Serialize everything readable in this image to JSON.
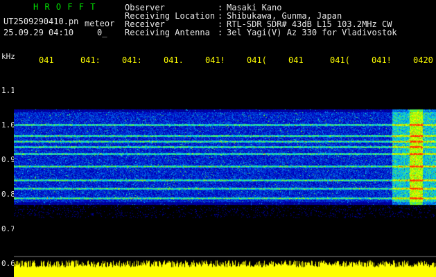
{
  "header": {
    "title": "H R O F F T",
    "filename": "UT2509290410.pn",
    "subtitle": "meteor",
    "datetime": "25.09.29 04:10",
    "status": "0_"
  },
  "info": [
    {
      "label": "Observer",
      "value": "Masaki Kano"
    },
    {
      "label": "Receiving Location",
      "value": "Shibukawa, Gunma, Japan"
    },
    {
      "label": "Receiver",
      "value": "RTL-SDR SDR# 43dB L15 103.2MHz CW"
    },
    {
      "label": "Receiving Antenna",
      "value": "3el Yagi(V) Az 330 for Vladivostok"
    }
  ],
  "axis": {
    "unit": "kHz",
    "y_ticks": [
      "1.1",
      "1.0",
      "0.9",
      "0.8",
      "0.7",
      "0.6"
    ],
    "time_ticks": [
      "041",
      "041:",
      "041:",
      "041.",
      "041!",
      "041(",
      "041",
      "041(",
      "041!",
      "0420"
    ]
  },
  "colors": {
    "title": "#00e000",
    "text": "#e8e8e8",
    "ticks": "#ffff00",
    "background": "#000000",
    "noise_band": "#ffff00"
  }
}
